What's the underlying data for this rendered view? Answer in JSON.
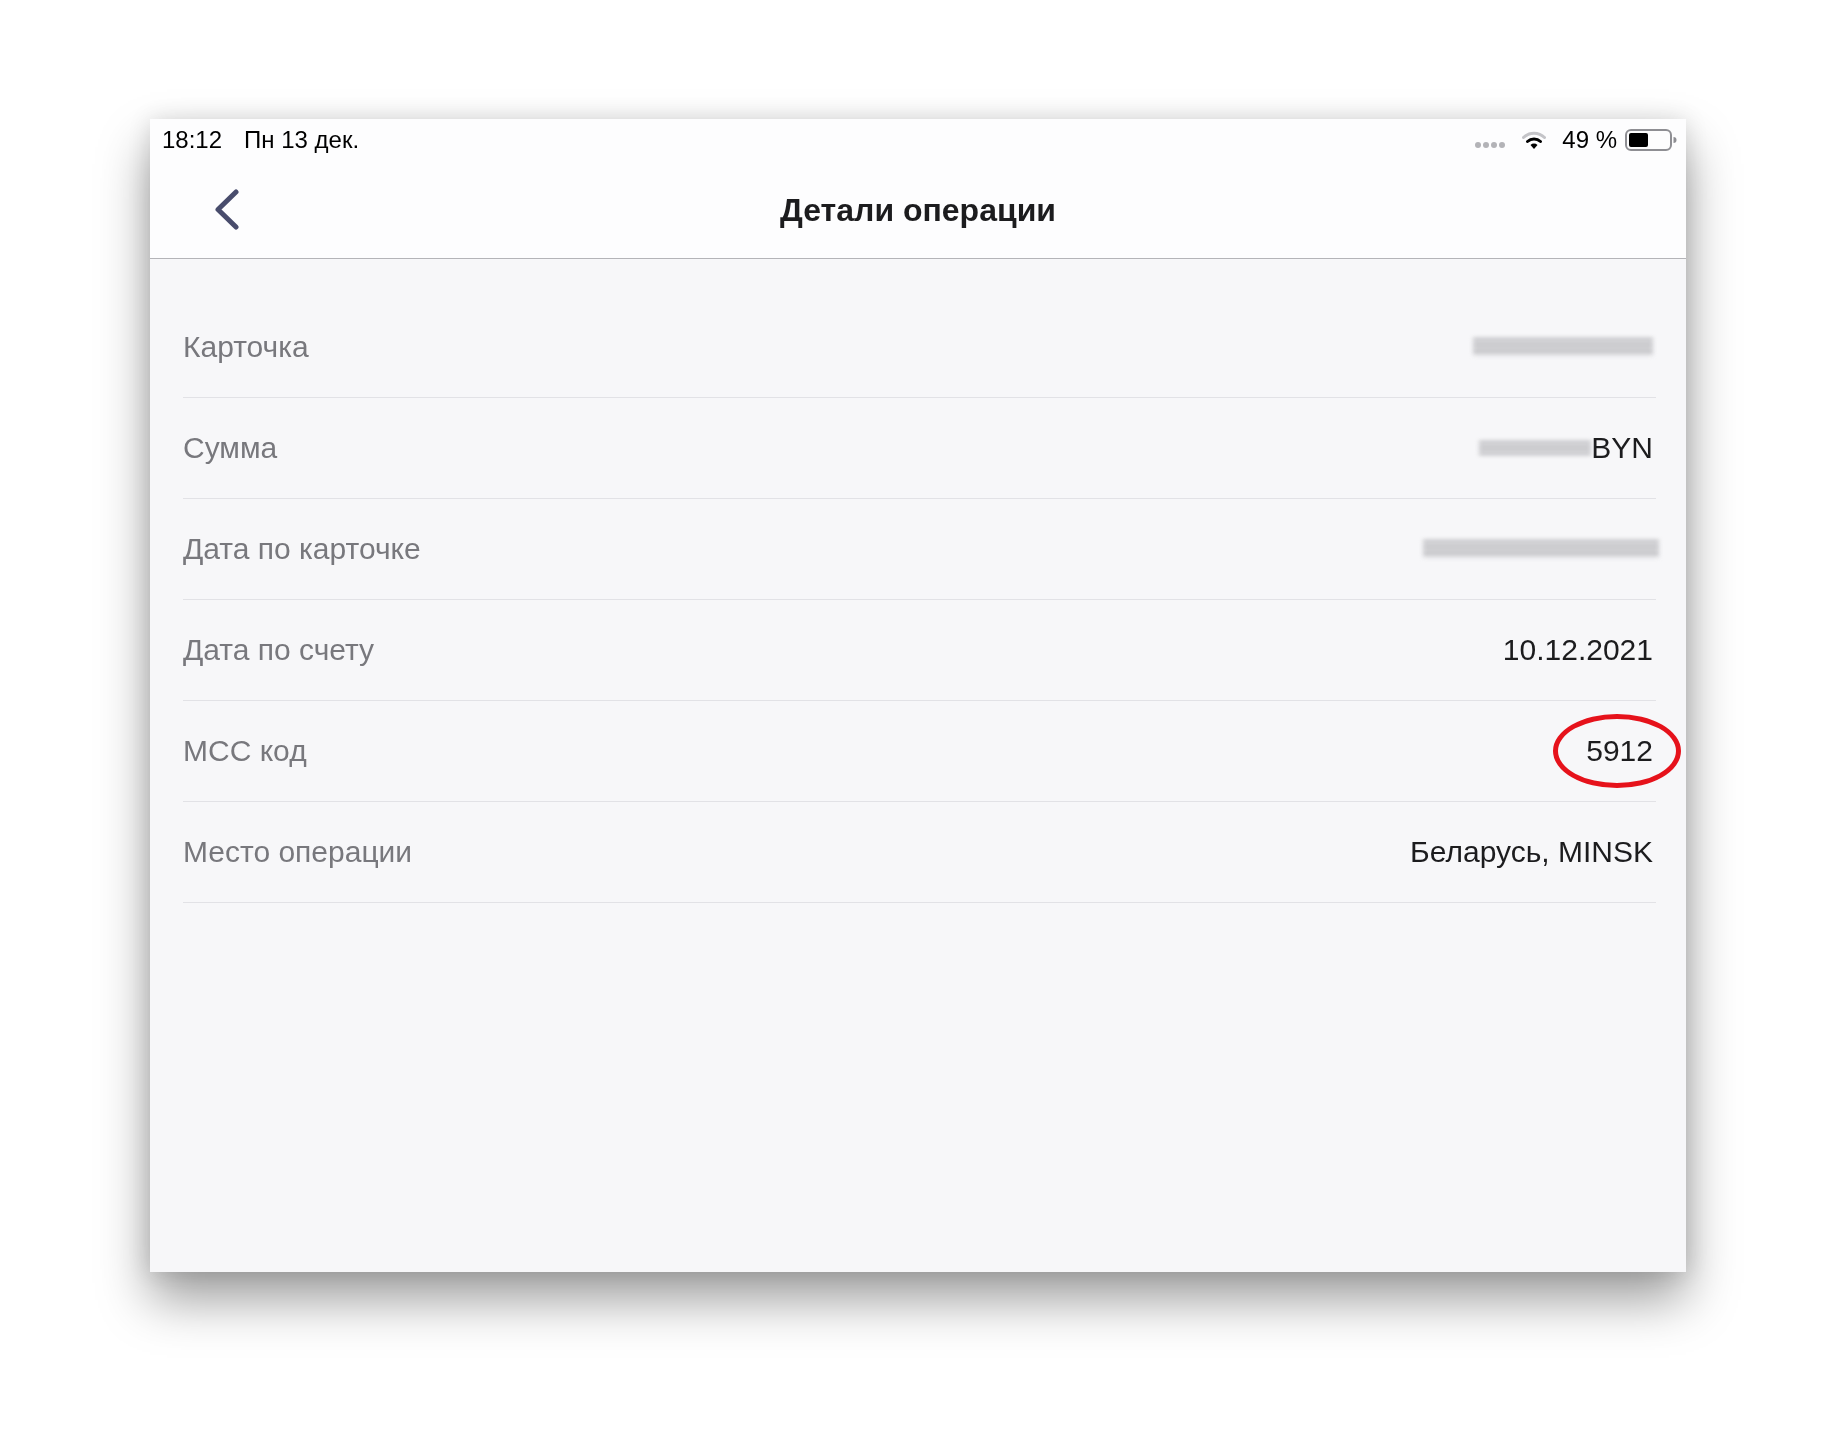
{
  "status_bar": {
    "time": "18:12",
    "date": "Пн 13 дек.",
    "battery": "49 %"
  },
  "nav_bar": {
    "title": "Детали операции"
  },
  "details": [
    {
      "label": "Карточка",
      "blurred": true,
      "circled": false
    },
    {
      "label": "Сумма",
      "blurred": true,
      "value": "BYN",
      "circled": false
    },
    {
      "label": "Дата по карточке",
      "blurred": true,
      "circled": false
    },
    {
      "label": "Дата по счету",
      "blurred": false,
      "value": "10.12.2021",
      "circled": false
    },
    {
      "label": "МСС код",
      "blurred": false,
      "value": "5912",
      "circled": true
    },
    {
      "label": "Место операции",
      "blurred": false,
      "value": "Беларусь, MINSK",
      "circled": false
    }
  ]
}
